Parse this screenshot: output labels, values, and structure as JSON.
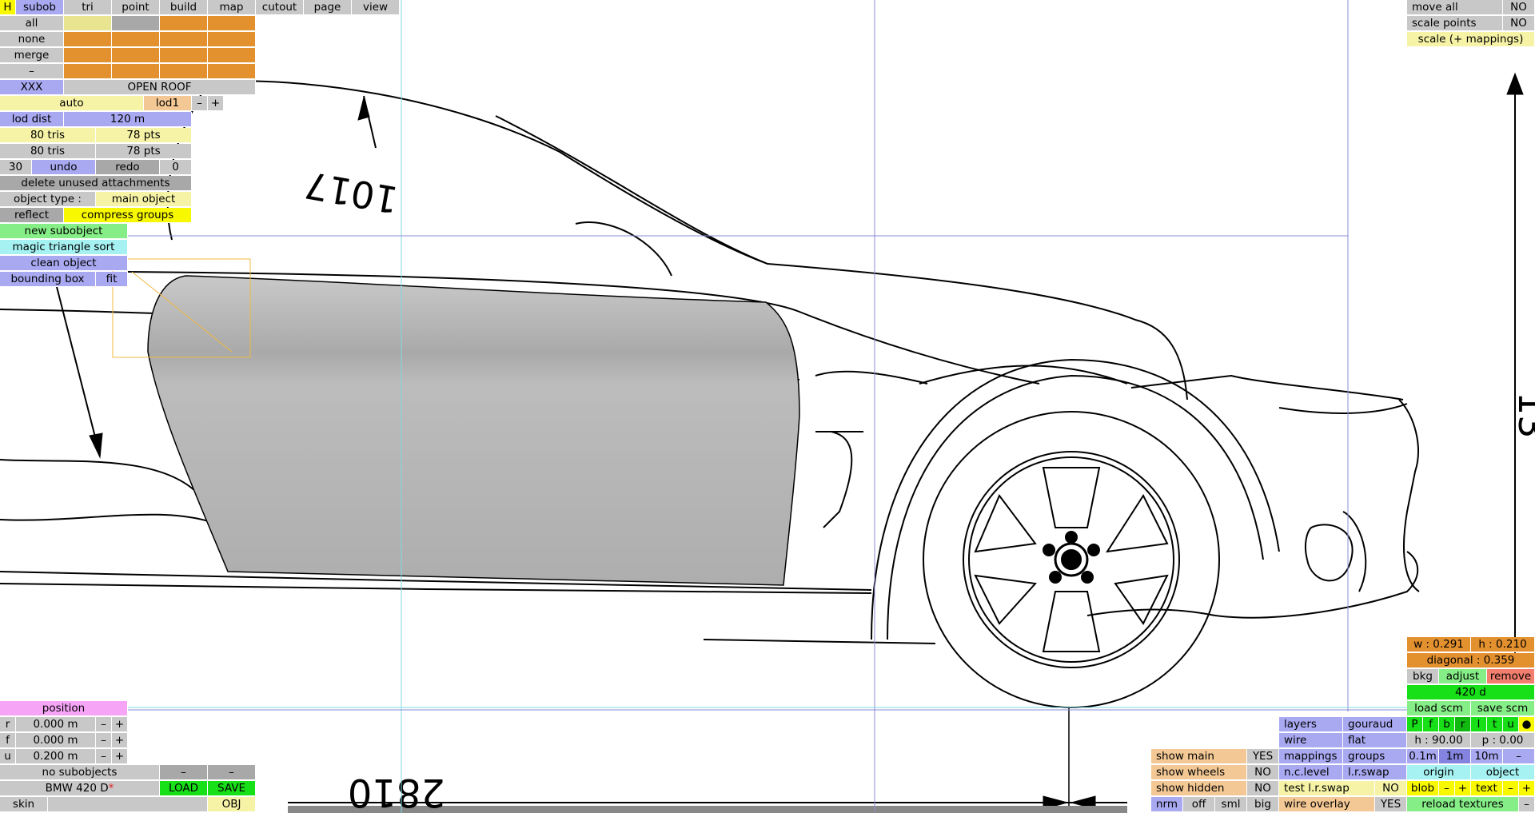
{
  "tabs": [
    {
      "label": "H",
      "color": "byel"
    },
    {
      "label": "subob",
      "color": "blue"
    },
    {
      "label": "tri",
      "color": "gray"
    },
    {
      "label": "point",
      "color": "gray"
    },
    {
      "label": "build",
      "color": "gray"
    },
    {
      "label": "map",
      "color": "gray"
    },
    {
      "label": "cutout",
      "color": "gray"
    },
    {
      "label": "page",
      "color": "gray"
    },
    {
      "label": "view",
      "color": "gray"
    }
  ],
  "selection": {
    "all": "all",
    "none": "none",
    "merge": "merge",
    "minus": "–"
  },
  "object": {
    "id_label": "XXX",
    "name": "OPEN ROOF",
    "auto": "auto",
    "lod": "lod1",
    "lod_minus": "–",
    "lod_plus": "+",
    "lod_dist_label": "lod dist",
    "lod_dist_value": "120 m",
    "tris_1": "80 tris",
    "pts_1": "78 pts",
    "tris_2": "80 tris",
    "pts_2": "78 pts",
    "undo_count": "30",
    "undo": "undo",
    "redo": "redo",
    "redo_count": "0",
    "delete_unused": "delete unused attachments",
    "object_type_label": "object type :",
    "object_type_value": "main object",
    "reflect": "reflect",
    "compress_groups": "compress groups",
    "new_subobject": "new subobject",
    "magic_sort": "magic triangle sort",
    "clean_object": "clean object",
    "bounding_box": "bounding box",
    "fit": "fit"
  },
  "position": {
    "title": "position",
    "rows": [
      {
        "axis": "r",
        "value": "0.000 m"
      },
      {
        "axis": "f",
        "value": "0.000 m"
      },
      {
        "axis": "u",
        "value": "0.200 m"
      }
    ],
    "minus": "–",
    "plus": "+"
  },
  "file": {
    "no_subobjects": "no subobjects",
    "dash1": "–",
    "dash2": "–",
    "car_name": "BMW 420 D",
    "modified_mark": "*",
    "load": "LOAD",
    "save": "SAVE",
    "skin": "skin",
    "obj": "OBJ"
  },
  "right_top": {
    "move_all": "move all",
    "move_all_val": "NO",
    "scale_points": "scale points",
    "scale_points_val": "NO",
    "scale_mappings": "scale (+ mappings)"
  },
  "right_bottom": {
    "w": "w : 0.291",
    "h": "h : 0.210",
    "diagonal": "diagonal : 0.359",
    "bkg": "bkg",
    "adjust": "adjust",
    "remove": "remove",
    "model": "420 d",
    "load_scm": "load scm",
    "save_scm": "save scm",
    "view_letters": [
      "P",
      "f",
      "b",
      "r",
      "l",
      "t",
      "u",
      "●"
    ],
    "h_angle": "h : 90.00",
    "p_angle": "p : 0.00",
    "grid": [
      "0.1m",
      "1m",
      "10m",
      "–"
    ],
    "origin": "origin",
    "object": "object",
    "blob": "blob",
    "text": "text",
    "minus": "–",
    "plus": "+",
    "reload": "reload textures"
  },
  "display": {
    "layers": "layers",
    "gouraud": "gouraud",
    "wire": "wire",
    "flat": "flat",
    "mappings": "mappings",
    "groups": "groups",
    "nc_level": "n.c.level",
    "lr_swap": "l.r.swap",
    "test_lr_swap": "test l.r.swap",
    "test_lr_swap_val": "NO",
    "wire_overlay": "wire overlay",
    "wire_overlay_val": "YES",
    "show_main": "show main",
    "show_main_val": "YES",
    "show_wheels": "show wheels",
    "show_wheels_val": "NO",
    "show_hidden": "show hidden",
    "show_hidden_val": "NO",
    "nrm": "nrm",
    "off": "off",
    "sml": "sml",
    "big": "big"
  },
  "blueprint": {
    "dim_top": "1017",
    "dim_bottom": "2810",
    "dim_right": "13"
  },
  "colors": {
    "panel_gray": "#c8c8c8",
    "panel_blue": "#a9a9f2",
    "panel_yellow": "#f6f3a6",
    "orange": "#e3902f",
    "green": "#18e018",
    "door_fill": "#b0b0b0",
    "guide_cyan": "#7fd8e6",
    "guide_blue": "#8b8bd6"
  }
}
